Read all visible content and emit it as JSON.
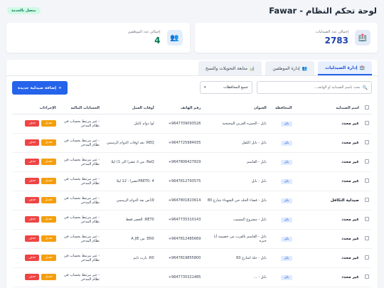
{
  "header": {
    "title": "لوحة تحكم النظام - Fawar",
    "status": "متصل بالخدمة"
  },
  "stats": {
    "pharmacies": {
      "label": "إجمالي عدد الصيدليات",
      "value": "2783"
    },
    "employees": {
      "label": "إجمالي عدد الموظفين",
      "value": "4"
    }
  },
  "tabs": [
    {
      "label": "إدارة الصيدليات",
      "icon": "🏥"
    },
    {
      "label": "إدارة الموظفين",
      "icon": "👥"
    },
    {
      "label": "متابعة التحويلات والنسخ",
      "icon": "📊"
    }
  ],
  "toolbar": {
    "search_placeholder": "بحث باسم الصيدلية أو الهاتف...",
    "gov_select": "جميع المحافظات",
    "add_button": "إضافة صيدلية جديدة",
    "add_icon": "+"
  },
  "table": {
    "headers": [
      "اسم الصيدلية",
      "المحافظة",
      "العنوان",
      "رقم الهاتف",
      "أوقات العمل",
      "الحسابات المالية",
      "الإجراءات"
    ],
    "edit_label": "تعديل",
    "delete_label": "حذف",
    "rows": [
      {
        "name": "غير محدد",
        "gov": "بابل",
        "address": "بابل - الحمزه الغربي المحتحية",
        "phone": "+9647709093526",
        "hours": "لوا دوام كامل",
        "finance": "- غير مرتبط بحساب في نظام المذخر"
      },
      {
        "name": "غير محدد",
        "gov": "بابل",
        "address": "بابل - بابل الكفل",
        "phone": "+9647725984935",
        "hours": "REQ: بعد اوقات الدوام الرسمي",
        "finance": "- غير مرتبط بحساب في نظام المذخر"
      },
      {
        "name": "غير محدد",
        "gov": "بابل",
        "address": "بابل - القاسم",
        "phone": "+9647806427829",
        "hours": "RaQ: من ٥ عصرا الى 1) ليلا",
        "finance": "- غير مرتبط بحساب في نظام المذخر"
      },
      {
        "name": "غير محدد",
        "gov": "بابل",
        "address": "بابل - بابل",
        "phone": "+9647812793575",
        "hours": "PRET0: 4عصرا - 12 ليلا",
        "finance": "- غير مرتبط بحساب في نظام المذخر"
      },
      {
        "name": "صيدلية التكافل",
        "gov": "بابل",
        "address": "بابل - قضاء الحله حي الشهداء شارع 80",
        "phone": "+9647801823614",
        "hours": "19ص بعد الدوام الرسمي",
        "finance": "- غير مرتبط بحساب في نظام المذخر"
      },
      {
        "name": "غير محدد",
        "gov": "بابل",
        "address": "بابل - مشروع المسيب",
        "phone": "+9647735310143",
        "hours": "RET0: العصر فقط",
        "finance": "- غير مرتبط بحساب في نظام المذخر"
      },
      {
        "name": "غير محدد",
        "gov": "بابل",
        "address": "بابل - القاسم بالقرب من خصيبية أبا خيره",
        "phone": "+9647812485669",
        "hours": "ER0: من A JIE",
        "finance": "- غير مرتبط بحساب في نظام المذخر"
      },
      {
        "name": "غير محدد",
        "gov": "بابل",
        "address": "بابل - حلة اشارع 60",
        "phone": "+9647819855800",
        "hours": "R0: بارت تايم",
        "finance": "- غير مرتبط بحساب في نظام المذخر"
      },
      {
        "name": "غير محدد",
        "gov": "بابل",
        "address": "بابل - ...",
        "phone": "+9647735321485",
        "hours": "",
        "finance": "- غير مرتبط بحساب في نظام المذخر"
      }
    ]
  }
}
